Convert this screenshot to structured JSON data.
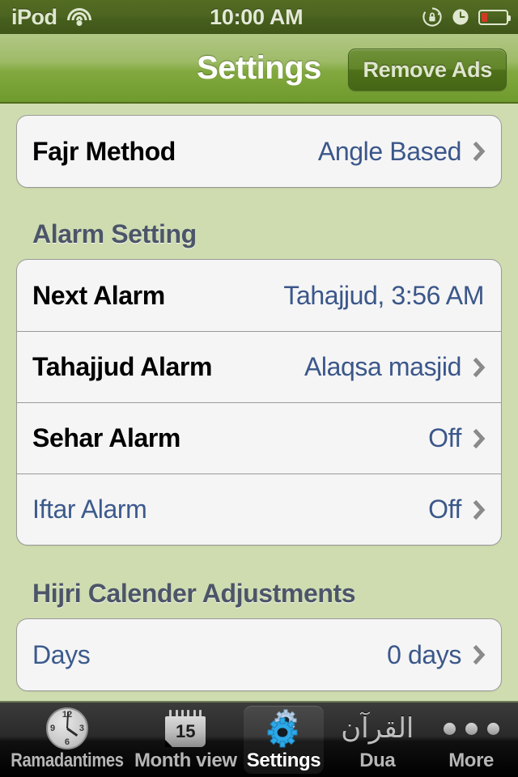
{
  "status_bar": {
    "carrier": "iPod",
    "wifi_icon": "wifi-icon",
    "time": "10:00 AM",
    "rotation_lock_icon": "rotation-lock-icon",
    "alarm_clock_icon": "alarm-clock-icon",
    "battery_icon": "battery-low-icon",
    "battery_level_percent": 22,
    "battery_color": "#cf3a22"
  },
  "nav_bar": {
    "title": "Settings",
    "remove_ads_label": "Remove Ads"
  },
  "theme": {
    "nav_green_light": "#b2c785",
    "nav_green_dark": "#6f9a2c",
    "page_background": "#cfdcb0",
    "row_background": "#f5f5f5",
    "value_blue": "#3b578a",
    "section_header_color": "#4c5568",
    "chevron_gray": "#8a8a8a"
  },
  "sections": [
    {
      "header": "",
      "rows": [
        {
          "label": "Fajr Method",
          "value": "Angle Based",
          "chevron": true,
          "label_style": "bold-black"
        }
      ]
    },
    {
      "header": "Alarm Setting",
      "rows": [
        {
          "label": "Next Alarm",
          "value": "Tahajjud,  3:56 AM",
          "chevron": false,
          "label_style": "bold-black"
        },
        {
          "label": "Tahajjud Alarm",
          "value": "Alaqsa masjid",
          "chevron": true,
          "label_style": "bold-black"
        },
        {
          "label": "Sehar Alarm",
          "value": "Off",
          "chevron": true,
          "label_style": "bold-black"
        },
        {
          "label": "Iftar Alarm",
          "value": "Off",
          "chevron": true,
          "label_style": "blue"
        }
      ]
    },
    {
      "header": "Hijri Calender Adjustments",
      "rows": [
        {
          "label": "Days",
          "value": "0 days",
          "chevron": true,
          "label_style": "blue"
        }
      ]
    }
  ],
  "tab_bar": {
    "tabs": [
      {
        "label": "Ramadantimes",
        "icon": "clock-icon",
        "selected": false
      },
      {
        "label": "Month view",
        "icon": "calendar-icon",
        "selected": false
      },
      {
        "label": "Settings",
        "icon": "gears-icon",
        "selected": true
      },
      {
        "label": "Dua",
        "icon": "quran-icon",
        "selected": false
      },
      {
        "label": "More",
        "icon": "more-dots-icon",
        "selected": false
      }
    ],
    "calendar_icon_day": "15",
    "quran_icon_text": "القرآن"
  }
}
